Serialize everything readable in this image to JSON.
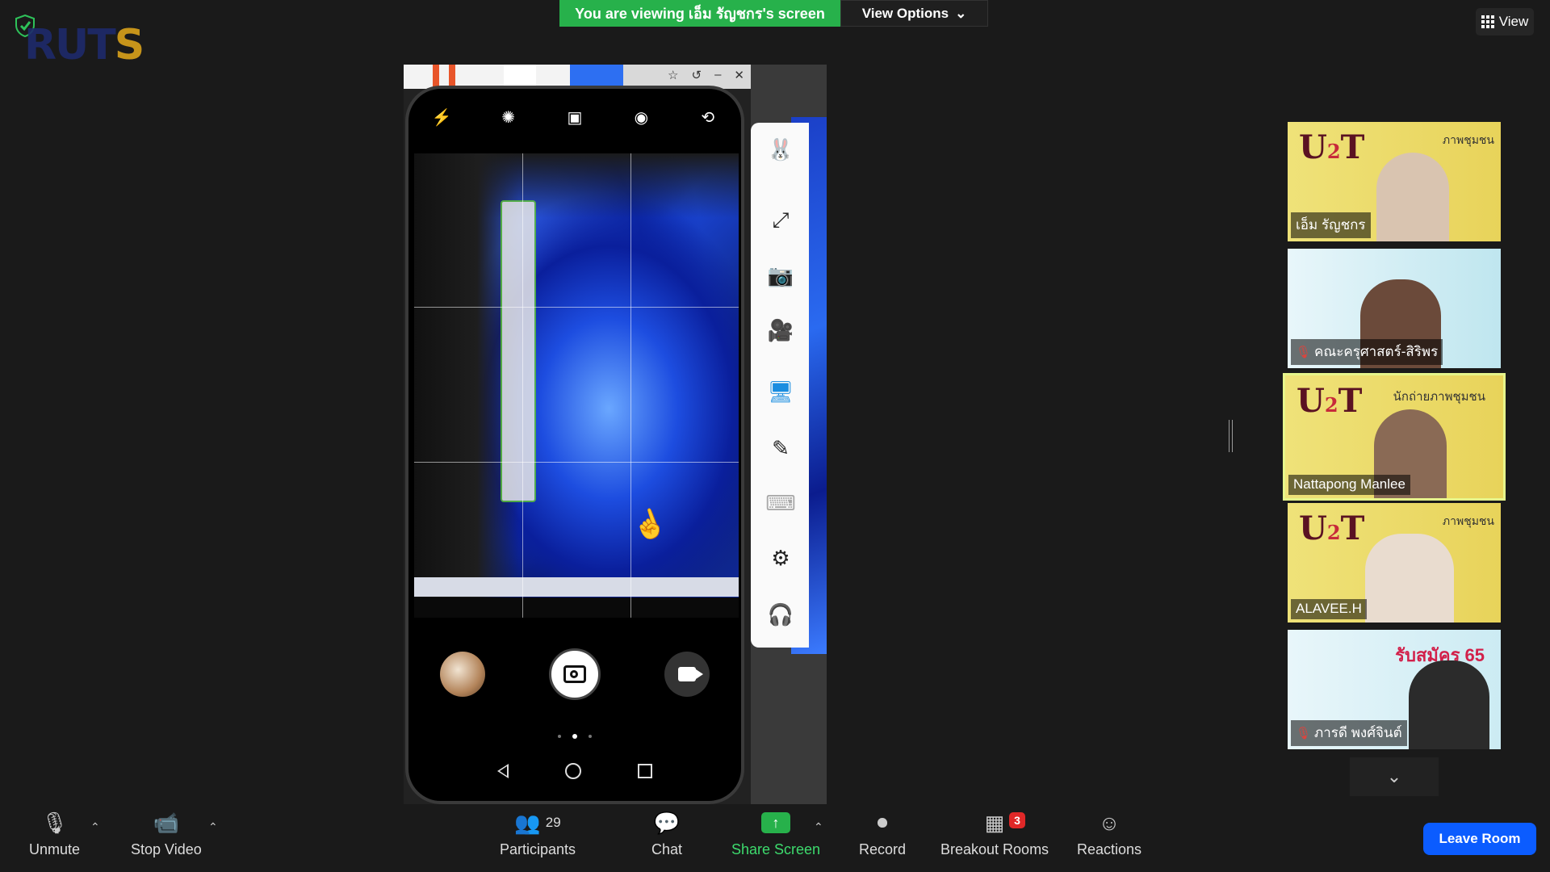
{
  "banner": {
    "viewing_text": "You are viewing เอ็ม รัญชกร's screen",
    "view_options_label": "View Options",
    "view_label": "View"
  },
  "logo": {
    "text_main": "RUT",
    "text_s": "S"
  },
  "phone_camera": {
    "top_icons": [
      "flash-icon",
      "aperture-icon",
      "portrait-icon",
      "live-icon",
      "switch-camera-icon"
    ],
    "side_panel_icons": [
      "mascot-icon",
      "fullscreen-icon",
      "screenshot-icon",
      "record-icon",
      "screen-cast-icon",
      "draw-icon",
      "keyboard-icon",
      "settings-icon",
      "support-icon"
    ]
  },
  "participants_gallery": [
    {
      "name": "เอ็ม รัญชกร",
      "muted": false,
      "active": false,
      "banner_text": "ภาพชุมชน"
    },
    {
      "name": "คณะครุศาสตร์-สิริพร",
      "muted": true,
      "active": false,
      "banner_text": ""
    },
    {
      "name": "Nattapong Manlee",
      "muted": false,
      "active": true,
      "banner_text": "นักถ่ายภาพชุมชน"
    },
    {
      "name": "ALAVEE.H",
      "muted": false,
      "active": false,
      "banner_text": "ภาพชุมชน"
    },
    {
      "name": "ภารดี พงศ์จินต์",
      "muted": true,
      "active": false,
      "banner_text": "รับสมัคร 65"
    }
  ],
  "toolbar": {
    "unmute": "Unmute",
    "stop_video": "Stop Video",
    "participants": "Participants",
    "participants_count": "29",
    "chat": "Chat",
    "share_screen": "Share Screen",
    "record": "Record",
    "breakout_rooms": "Breakout Rooms",
    "breakout_badge": "3",
    "reactions": "Reactions",
    "leave": "Leave Room"
  },
  "colors": {
    "viewing_banner": "#27b14b",
    "leave_button": "#0b5cff",
    "share_screen_green": "#3ddb6d",
    "active_speaker_border": "#e6f58b",
    "badge_red": "#e02828"
  }
}
